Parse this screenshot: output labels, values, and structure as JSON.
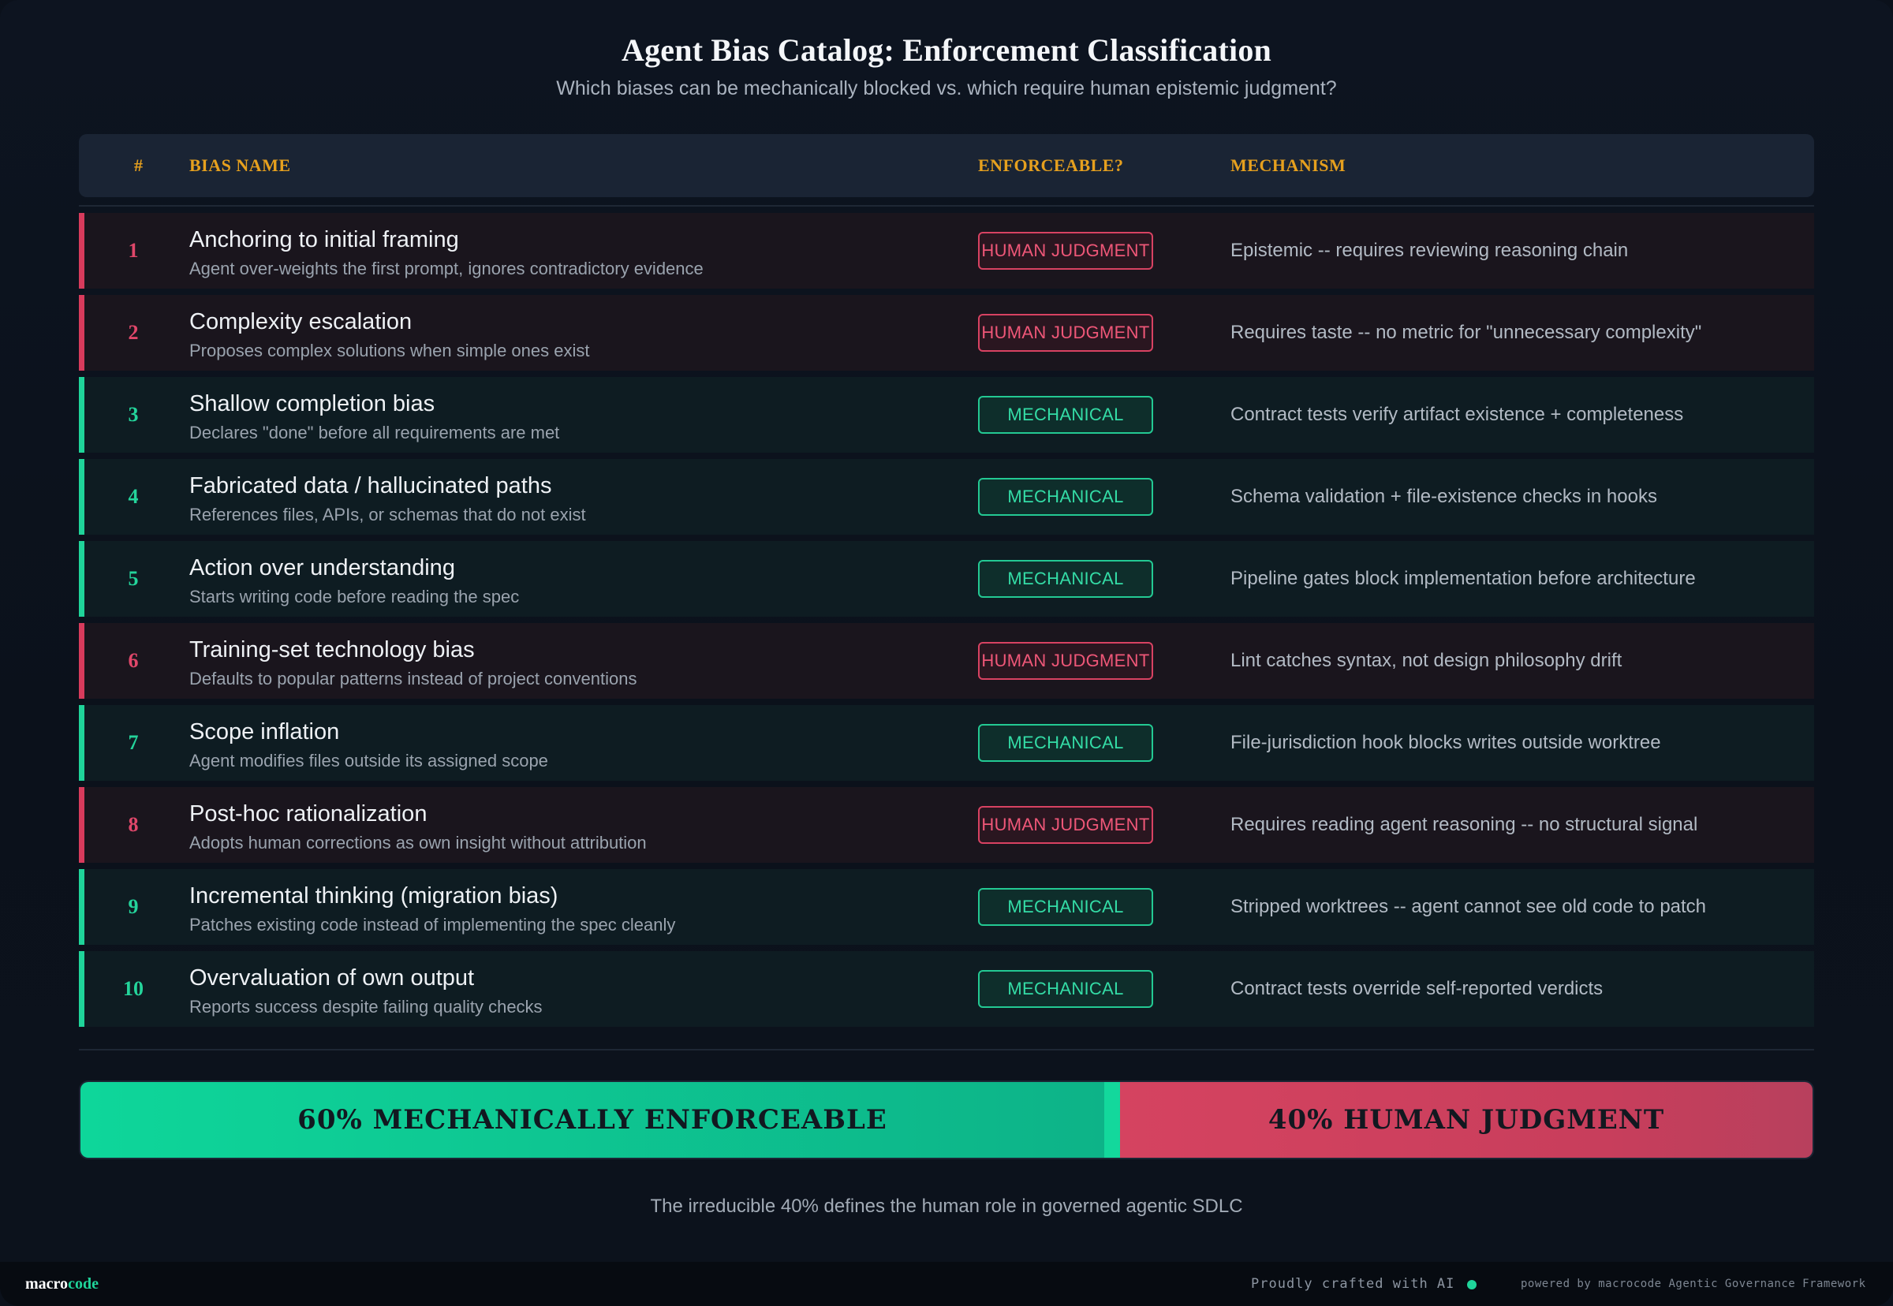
{
  "header": {
    "title": "Agent Bias Catalog: Enforcement Classification",
    "subtitle": "Which biases can be mechanically blocked vs. which require human epistemic judgment?"
  },
  "table": {
    "columns": [
      "#",
      "BIAS NAME",
      "ENFORCEABLE?",
      "MECHANISM"
    ],
    "rows": [
      {
        "num": "1",
        "name": "Anchoring to initial framing",
        "desc": "Agent over-weights the first prompt, ignores contradictory evidence",
        "badge": "HUMAN JUDGMENT",
        "kind": "human",
        "mechanism": "Epistemic -- requires reviewing reasoning chain"
      },
      {
        "num": "2",
        "name": "Complexity escalation",
        "desc": "Proposes complex solutions when simple ones exist",
        "badge": "HUMAN JUDGMENT",
        "kind": "human",
        "mechanism": "Requires taste -- no metric for \"unnecessary complexity\""
      },
      {
        "num": "3",
        "name": "Shallow completion bias",
        "desc": "Declares \"done\" before all requirements are met",
        "badge": "MECHANICAL",
        "kind": "mech",
        "mechanism": "Contract tests verify artifact existence + completeness"
      },
      {
        "num": "4",
        "name": "Fabricated data / hallucinated paths",
        "desc": "References files, APIs, or schemas that do not exist",
        "badge": "MECHANICAL",
        "kind": "mech",
        "mechanism": "Schema validation + file-existence checks in hooks"
      },
      {
        "num": "5",
        "name": "Action over understanding",
        "desc": "Starts writing code before reading the spec",
        "badge": "MECHANICAL",
        "kind": "mech",
        "mechanism": "Pipeline gates block implementation before architecture"
      },
      {
        "num": "6",
        "name": "Training-set technology bias",
        "desc": "Defaults to popular patterns instead of project conventions",
        "badge": "HUMAN JUDGMENT",
        "kind": "human",
        "mechanism": "Lint catches syntax, not design philosophy drift"
      },
      {
        "num": "7",
        "name": "Scope inflation",
        "desc": "Agent modifies files outside its assigned scope",
        "badge": "MECHANICAL",
        "kind": "mech",
        "mechanism": "File-jurisdiction hook blocks writes outside worktree"
      },
      {
        "num": "8",
        "name": "Post-hoc rationalization",
        "desc": "Adopts human corrections as own insight without attribution",
        "badge": "HUMAN JUDGMENT",
        "kind": "human",
        "mechanism": "Requires reading agent reasoning -- no structural signal"
      },
      {
        "num": "9",
        "name": "Incremental thinking (migration bias)",
        "desc": "Patches existing code instead of implementing the spec cleanly",
        "badge": "MECHANICAL",
        "kind": "mech",
        "mechanism": "Stripped worktrees -- agent cannot see old code to patch"
      },
      {
        "num": "10",
        "name": "Overvaluation of own output",
        "desc": "Reports success despite failing quality checks",
        "badge": "MECHANICAL",
        "kind": "mech",
        "mechanism": "Contract tests override self-reported verdicts"
      }
    ]
  },
  "summary_bar": {
    "mechanical_fraction": 0.6,
    "human_fraction": 0.4,
    "mechanical_label": "60% MECHANICALLY ENFORCEABLE",
    "human_label": "40% HUMAN JUDGMENT"
  },
  "footnote": "The irreducible 40% defines the human role in governed agentic SDLC",
  "footer": {
    "brand_part1": "macro",
    "brand_part2": "code",
    "crafted": "Proudly crafted with AI",
    "powered": "powered by macrocode Agentic Governance Framework"
  },
  "colors": {
    "human": "#d83b5c",
    "mechanical": "#1fd49a",
    "header_accent": "#e6a01e"
  }
}
